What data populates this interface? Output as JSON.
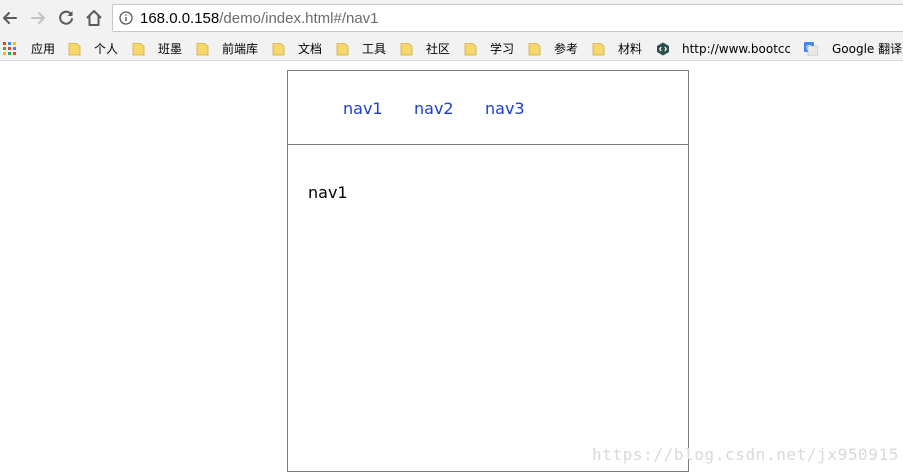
{
  "browser": {
    "url_host": "168.0.0.158",
    "url_path": "/demo/index.html#/nav1",
    "icons": {
      "back": "arrow-left-icon",
      "forward": "arrow-right-icon",
      "reload": "reload-icon",
      "home": "home-icon",
      "info": "info-icon"
    },
    "bookmarks": [
      {
        "label": "应用",
        "icon": "apps-grid-icon"
      },
      {
        "label": "个人",
        "icon": "folder-icon"
      },
      {
        "label": "班墨",
        "icon": "folder-icon"
      },
      {
        "label": "前端库",
        "icon": "folder-icon"
      },
      {
        "label": "文档",
        "icon": "folder-icon"
      },
      {
        "label": "工具",
        "icon": "folder-icon"
      },
      {
        "label": "社区",
        "icon": "folder-icon"
      },
      {
        "label": "学习",
        "icon": "folder-icon"
      },
      {
        "label": "参考",
        "icon": "folder-icon"
      },
      {
        "label": "材料",
        "icon": "folder-icon"
      },
      {
        "label": "http://www.bootcc",
        "icon": "bootcdn-icon"
      },
      {
        "label": "Google 翻译",
        "icon": "google-translate-icon"
      }
    ]
  },
  "page": {
    "nav": [
      {
        "label": "nav1"
      },
      {
        "label": "nav2"
      },
      {
        "label": "nav3"
      }
    ],
    "view_text": "nav1"
  },
  "watermark": "https://blog.csdn.net/jx950915",
  "colors": {
    "link": "#1a3fc9",
    "border": "#7f7f7f",
    "chrome_bg": "#f2f2f2",
    "folder": "#f5d76e",
    "watermark": "#d9d9d9"
  }
}
